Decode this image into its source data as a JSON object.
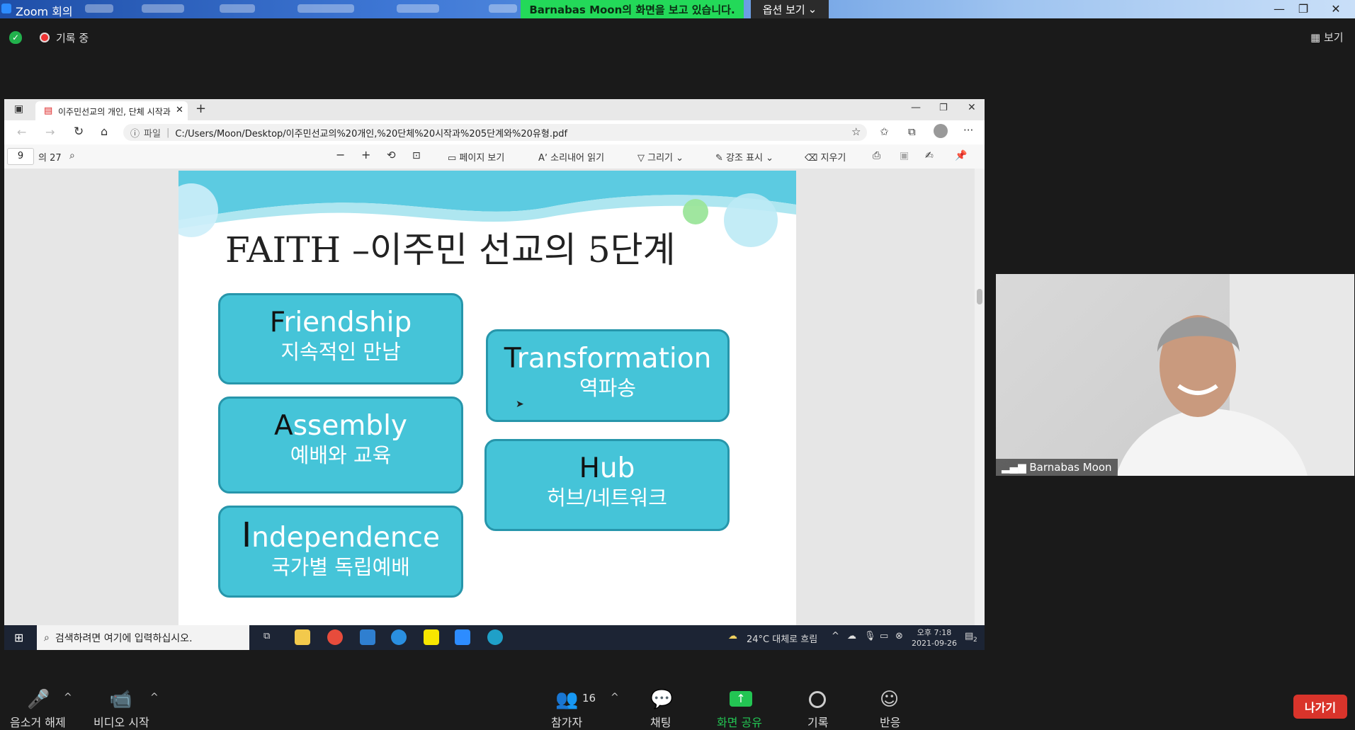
{
  "zoom": {
    "window_title": "Zoom 회의",
    "share_banner": "Barnabas  Moon의 화면을 보고 있습니다.",
    "view_options": "옵션 보기",
    "recording": "기록 중",
    "view_label": "보기",
    "participant_name": "Barnabas Moon",
    "participant_count": "16",
    "controls": {
      "unmute": "음소거 해제",
      "start_video": "비디오 시작",
      "participants": "참가자",
      "chat": "채팅",
      "share_screen": "화면 공유",
      "record": "기록",
      "reactions": "반응",
      "leave": "나가기"
    }
  },
  "browser": {
    "tab_title": "이주민선교의 개인, 단체 시작과",
    "url_prefix": "파일",
    "url": "C:/Users/Moon/Desktop/이주민선교의%20개인,%20단체%20시작과%205단계와%20유형.pdf",
    "page_number": "9",
    "page_total": "의 27",
    "toolbar": {
      "page_view": "페이지 보기",
      "read_aloud": "소리내어 읽기",
      "draw": "그리기",
      "highlight": "강조 표시",
      "erase": "지우기"
    }
  },
  "slide": {
    "title": "FAITH –이주민 선교의 5단계",
    "stages": [
      {
        "initial": "F",
        "rest": "riendship",
        "korean": "지속적인 만남"
      },
      {
        "initial": "A",
        "rest": "ssembly",
        "korean": "예배와 교육"
      },
      {
        "initial": "I",
        "rest": "ndependence",
        "korean": "국가별 독립예배"
      },
      {
        "initial": "T",
        "rest": "ransformation",
        "korean": "역파송"
      },
      {
        "initial": "H",
        "rest": "ub",
        "korean": "허브/네트워크"
      }
    ]
  },
  "taskbar": {
    "search_placeholder": "검색하려면 여기에 입력하십시오.",
    "weather": "24°C  대체로 흐림",
    "time": "오후 7:18",
    "date": "2021-09-26",
    "notification_count": "2"
  },
  "colors": {
    "share_green": "#23d959",
    "box_fill": "#45c4d8",
    "box_border": "#2796ab",
    "leave_red": "#d9342b"
  }
}
